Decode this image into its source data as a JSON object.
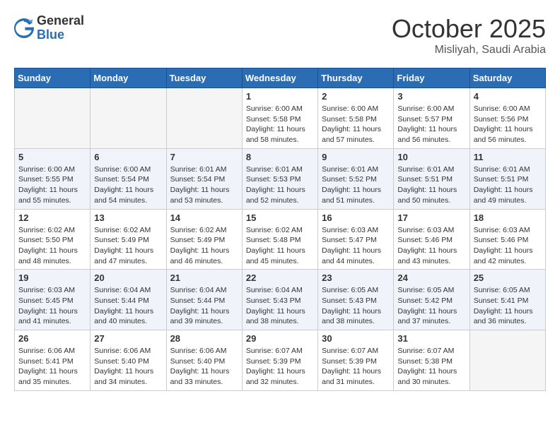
{
  "header": {
    "logo_general": "General",
    "logo_blue": "Blue",
    "month": "October 2025",
    "location": "Misliyah, Saudi Arabia"
  },
  "weekdays": [
    "Sunday",
    "Monday",
    "Tuesday",
    "Wednesday",
    "Thursday",
    "Friday",
    "Saturday"
  ],
  "weeks": [
    [
      {
        "day": "",
        "empty": true
      },
      {
        "day": "",
        "empty": true
      },
      {
        "day": "",
        "empty": true
      },
      {
        "day": "1",
        "sunrise": "6:00 AM",
        "sunset": "5:58 PM",
        "daylight": "11 hours and 58 minutes."
      },
      {
        "day": "2",
        "sunrise": "6:00 AM",
        "sunset": "5:58 PM",
        "daylight": "11 hours and 57 minutes."
      },
      {
        "day": "3",
        "sunrise": "6:00 AM",
        "sunset": "5:57 PM",
        "daylight": "11 hours and 56 minutes."
      },
      {
        "day": "4",
        "sunrise": "6:00 AM",
        "sunset": "5:56 PM",
        "daylight": "11 hours and 56 minutes."
      }
    ],
    [
      {
        "day": "5",
        "sunrise": "6:00 AM",
        "sunset": "5:55 PM",
        "daylight": "11 hours and 55 minutes."
      },
      {
        "day": "6",
        "sunrise": "6:00 AM",
        "sunset": "5:54 PM",
        "daylight": "11 hours and 54 minutes."
      },
      {
        "day": "7",
        "sunrise": "6:01 AM",
        "sunset": "5:54 PM",
        "daylight": "11 hours and 53 minutes."
      },
      {
        "day": "8",
        "sunrise": "6:01 AM",
        "sunset": "5:53 PM",
        "daylight": "11 hours and 52 minutes."
      },
      {
        "day": "9",
        "sunrise": "6:01 AM",
        "sunset": "5:52 PM",
        "daylight": "11 hours and 51 minutes."
      },
      {
        "day": "10",
        "sunrise": "6:01 AM",
        "sunset": "5:51 PM",
        "daylight": "11 hours and 50 minutes."
      },
      {
        "day": "11",
        "sunrise": "6:01 AM",
        "sunset": "5:51 PM",
        "daylight": "11 hours and 49 minutes."
      }
    ],
    [
      {
        "day": "12",
        "sunrise": "6:02 AM",
        "sunset": "5:50 PM",
        "daylight": "11 hours and 48 minutes."
      },
      {
        "day": "13",
        "sunrise": "6:02 AM",
        "sunset": "5:49 PM",
        "daylight": "11 hours and 47 minutes."
      },
      {
        "day": "14",
        "sunrise": "6:02 AM",
        "sunset": "5:49 PM",
        "daylight": "11 hours and 46 minutes."
      },
      {
        "day": "15",
        "sunrise": "6:02 AM",
        "sunset": "5:48 PM",
        "daylight": "11 hours and 45 minutes."
      },
      {
        "day": "16",
        "sunrise": "6:03 AM",
        "sunset": "5:47 PM",
        "daylight": "11 hours and 44 minutes."
      },
      {
        "day": "17",
        "sunrise": "6:03 AM",
        "sunset": "5:46 PM",
        "daylight": "11 hours and 43 minutes."
      },
      {
        "day": "18",
        "sunrise": "6:03 AM",
        "sunset": "5:46 PM",
        "daylight": "11 hours and 42 minutes."
      }
    ],
    [
      {
        "day": "19",
        "sunrise": "6:03 AM",
        "sunset": "5:45 PM",
        "daylight": "11 hours and 41 minutes."
      },
      {
        "day": "20",
        "sunrise": "6:04 AM",
        "sunset": "5:44 PM",
        "daylight": "11 hours and 40 minutes."
      },
      {
        "day": "21",
        "sunrise": "6:04 AM",
        "sunset": "5:44 PM",
        "daylight": "11 hours and 39 minutes."
      },
      {
        "day": "22",
        "sunrise": "6:04 AM",
        "sunset": "5:43 PM",
        "daylight": "11 hours and 38 minutes."
      },
      {
        "day": "23",
        "sunrise": "6:05 AM",
        "sunset": "5:43 PM",
        "daylight": "11 hours and 38 minutes."
      },
      {
        "day": "24",
        "sunrise": "6:05 AM",
        "sunset": "5:42 PM",
        "daylight": "11 hours and 37 minutes."
      },
      {
        "day": "25",
        "sunrise": "6:05 AM",
        "sunset": "5:41 PM",
        "daylight": "11 hours and 36 minutes."
      }
    ],
    [
      {
        "day": "26",
        "sunrise": "6:06 AM",
        "sunset": "5:41 PM",
        "daylight": "11 hours and 35 minutes."
      },
      {
        "day": "27",
        "sunrise": "6:06 AM",
        "sunset": "5:40 PM",
        "daylight": "11 hours and 34 minutes."
      },
      {
        "day": "28",
        "sunrise": "6:06 AM",
        "sunset": "5:40 PM",
        "daylight": "11 hours and 33 minutes."
      },
      {
        "day": "29",
        "sunrise": "6:07 AM",
        "sunset": "5:39 PM",
        "daylight": "11 hours and 32 minutes."
      },
      {
        "day": "30",
        "sunrise": "6:07 AM",
        "sunset": "5:39 PM",
        "daylight": "11 hours and 31 minutes."
      },
      {
        "day": "31",
        "sunrise": "6:07 AM",
        "sunset": "5:38 PM",
        "daylight": "11 hours and 30 minutes."
      },
      {
        "day": "",
        "empty": true
      }
    ]
  ]
}
